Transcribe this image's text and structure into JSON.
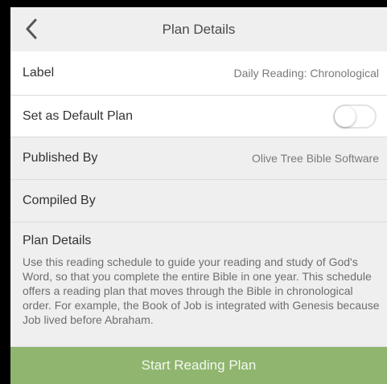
{
  "navbar": {
    "title": "Plan Details",
    "back_icon": "chevron-left-icon"
  },
  "rows": {
    "label": {
      "label": "Label",
      "value": "Daily Reading: Chronological"
    },
    "default_plan": {
      "label": "Set as Default Plan",
      "toggle_on": false
    },
    "published_by": {
      "label": "Published By",
      "value": "Olive Tree Bible Software"
    },
    "compiled_by": {
      "label": "Compiled By",
      "value": ""
    }
  },
  "details": {
    "title": "Plan Details",
    "body": "Use this reading schedule to guide your reading and study of God's Word, so that you complete the entire Bible in one year. This schedule offers a reading plan that moves through the Bible in chronological order. For example, the Book of Job is integrated with Genesis because Job lived before Abraham."
  },
  "start_button": {
    "label": "Start Reading Plan"
  },
  "colors": {
    "accent": "#8fb56f",
    "nav_background": "#efefef",
    "row_white": "#ffffff",
    "row_grey": "#efefef"
  }
}
